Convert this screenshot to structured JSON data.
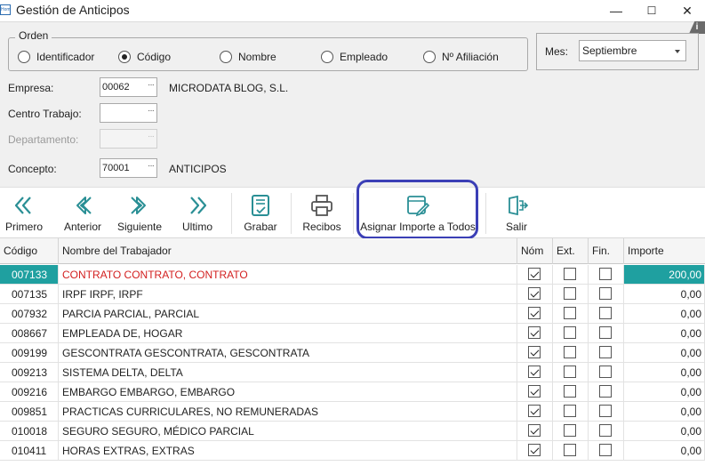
{
  "window": {
    "app_icon_text": "Hom",
    "title": "Gestión de Anticipos",
    "minimize": "—",
    "maximize": "☐",
    "close": "✕",
    "info_badge": "i"
  },
  "orden": {
    "legend": "Orden",
    "options": [
      "Identificador",
      "Código",
      "Nombre",
      "Empleado",
      "Nº Afiliación"
    ],
    "selected": "Código"
  },
  "mes": {
    "label": "Mes:",
    "value": "Septiembre"
  },
  "fields": {
    "empresa": {
      "label": "Empresa:",
      "code": "00062",
      "desc": "MICRODATA BLOG, S.L."
    },
    "centro": {
      "label": "Centro Trabajo:",
      "code": "",
      "desc": ""
    },
    "departamento": {
      "label": "Departamento:",
      "code": "",
      "desc": ""
    },
    "concepto": {
      "label": "Concepto:",
      "code": "70001",
      "desc": "ANTICIPOS"
    },
    "lookup_dots": "···"
  },
  "toolbar": {
    "primero": "Primero",
    "anterior": "Anterior",
    "siguiente": "Siguiente",
    "ultimo": "Ultimo",
    "grabar": "Grabar",
    "recibos": "Recibos",
    "asignar": "Asignar Importe a Todos",
    "salir": "Salir"
  },
  "colors": {
    "accent": "#1fa0a0",
    "icon": "#2a8f95",
    "highlight": "#3b3fb6",
    "selected_text": "#d32020"
  },
  "grid": {
    "headers": [
      "Código",
      "Nombre del Trabajador",
      "Nóm",
      "Ext.",
      "Fin.",
      "Importe"
    ],
    "rows": [
      {
        "code": "007133",
        "name": "CONTRATO CONTRATO, CONTRATO",
        "nom": true,
        "ext": false,
        "fin": false,
        "importe": "200,00",
        "selected": true
      },
      {
        "code": "007135",
        "name": "IRPF IRPF, IRPF",
        "nom": true,
        "ext": false,
        "fin": false,
        "importe": "0,00"
      },
      {
        "code": "007932",
        "name": "PARCIA PARCIAL, PARCIAL",
        "nom": true,
        "ext": false,
        "fin": false,
        "importe": "0,00"
      },
      {
        "code": "008667",
        "name": "EMPLEADA DE, HOGAR",
        "nom": true,
        "ext": false,
        "fin": false,
        "importe": "0,00"
      },
      {
        "code": "009199",
        "name": "GESCONTRATA GESCONTRATA, GESCONTRATA",
        "nom": true,
        "ext": false,
        "fin": false,
        "importe": "0,00"
      },
      {
        "code": "009213",
        "name": "SISTEMA DELTA, DELTA",
        "nom": true,
        "ext": false,
        "fin": false,
        "importe": "0,00"
      },
      {
        "code": "009216",
        "name": "EMBARGO EMBARGO, EMBARGO",
        "nom": true,
        "ext": false,
        "fin": false,
        "importe": "0,00"
      },
      {
        "code": "009851",
        "name": "PRACTICAS CURRICULARES, NO REMUNERADAS",
        "nom": true,
        "ext": false,
        "fin": false,
        "importe": "0,00"
      },
      {
        "code": "010018",
        "name": "SEGURO SEGURO, MÉDICO PARCIAL",
        "nom": true,
        "ext": false,
        "fin": false,
        "importe": "0,00"
      },
      {
        "code": "010411",
        "name": "HORAS EXTRAS, EXTRAS",
        "nom": true,
        "ext": false,
        "fin": false,
        "importe": "0,00"
      }
    ]
  }
}
